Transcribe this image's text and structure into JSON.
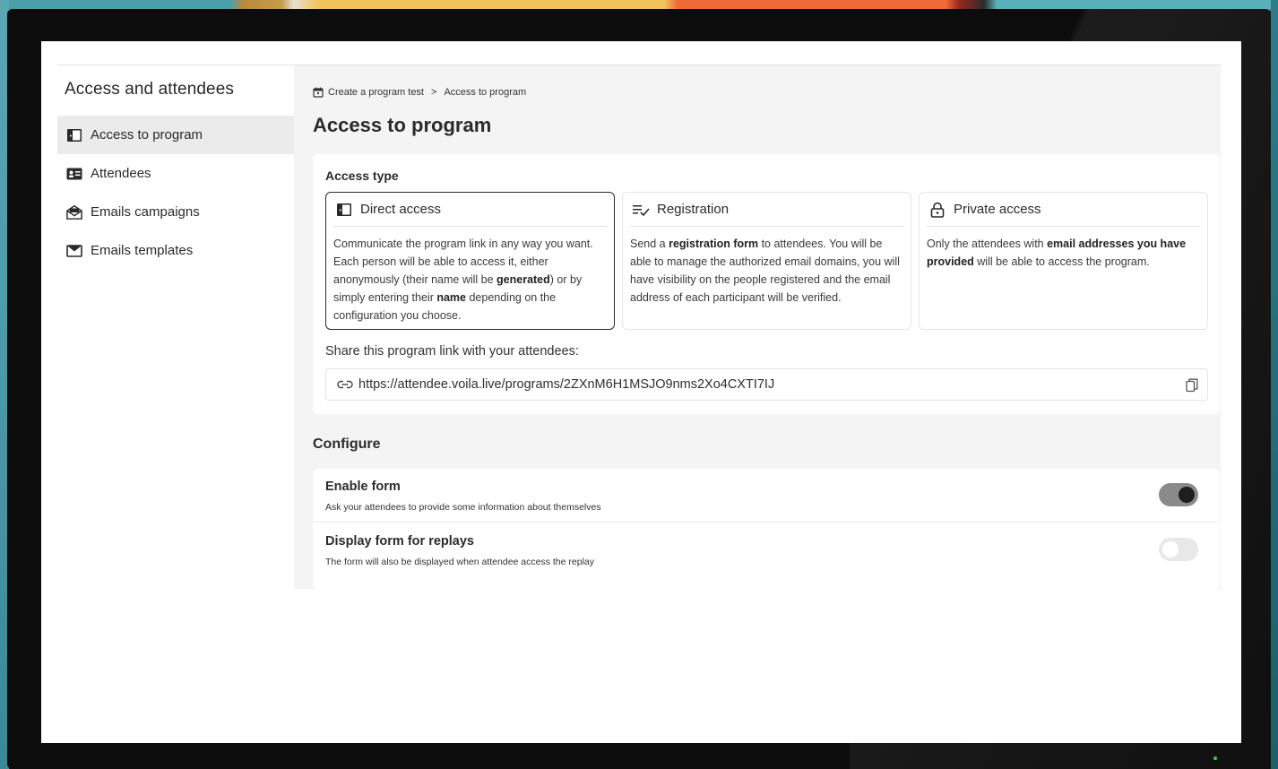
{
  "sidebar": {
    "title": "Access and attendees",
    "items": [
      {
        "label": "Access to program",
        "icon": "door-icon",
        "active": true
      },
      {
        "label": "Attendees",
        "icon": "id-card-icon",
        "active": false
      },
      {
        "label": "Emails campaigns",
        "icon": "envelope-open-icon",
        "active": false
      },
      {
        "label": "Emails templates",
        "icon": "envelope-icon",
        "active": false
      }
    ]
  },
  "breadcrumb": {
    "parent": "Create a program test",
    "separator": ">",
    "current": "Access to program"
  },
  "page_title": "Access to program",
  "access": {
    "section_label": "Access type",
    "options": [
      {
        "title": "Direct access",
        "icon": "door-icon",
        "selected": true,
        "desc_1": "Communicate the program link in any way you want. Each person will be able to access it, either anonymously (their name will be ",
        "desc_b1": "generated",
        "desc_2": ") or by simply entering their ",
        "desc_b2": "name",
        "desc_3": " depending on the configuration you choose."
      },
      {
        "title": "Registration",
        "icon": "list-check-icon",
        "selected": false,
        "desc_1": "Send a ",
        "desc_b1": "registration form",
        "desc_2": " to attendees. You will be able to manage the authorized email domains, you will have visibility on the people registered and the email address of each participant will be verified."
      },
      {
        "title": "Private access",
        "icon": "lock-icon",
        "selected": false,
        "desc_1": "Only the attendees with ",
        "desc_b1": "email addresses you have provided",
        "desc_2": " will be able to access the program."
      }
    ],
    "share_label": "Share this program link with your attendees:",
    "link": "https://attendee.voila.live/programs/2ZXnM6H1MSJO9nms2Xo4CXTI7IJ"
  },
  "configure": {
    "title": "Configure",
    "rows": [
      {
        "title": "Enable form",
        "desc": "Ask your attendees to provide some information about themselves",
        "enabled": true
      },
      {
        "title": "Display form for replays",
        "desc": "The form will also be displayed when attendee access the replay",
        "enabled": false
      }
    ]
  },
  "colors": {
    "active_nav_bg": "#ebebeb",
    "main_bg": "#f4f4f4",
    "toggle_on_track": "#8a8a8a",
    "toggle_on_knob": "#1e1e1e",
    "toggle_off_track": "#e8e8e8"
  }
}
